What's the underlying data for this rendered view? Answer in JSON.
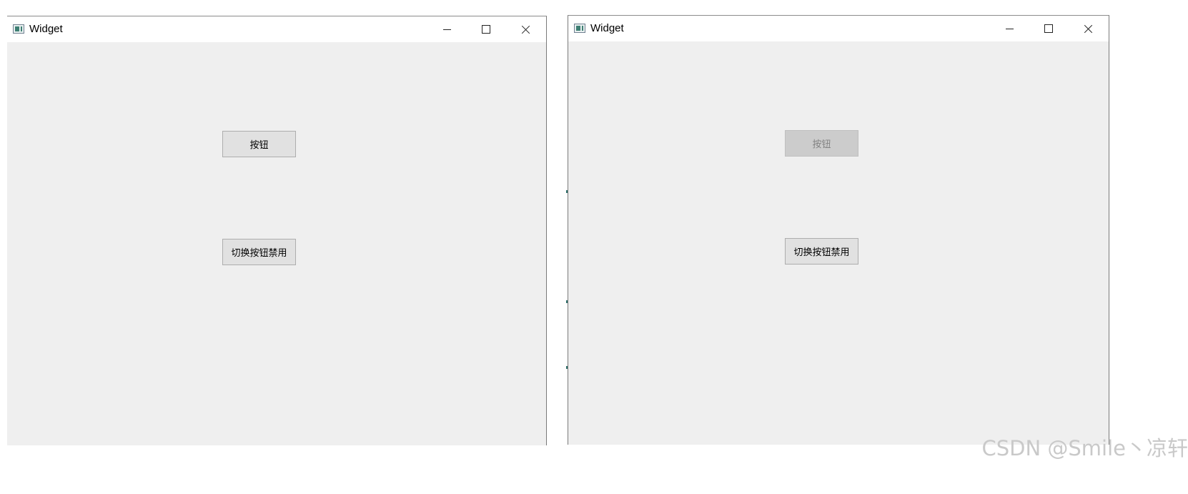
{
  "windows": [
    {
      "title": "Widget",
      "buttons": [
        {
          "label": "按钮",
          "state": "enabled"
        },
        {
          "label": "切换按钮禁用",
          "state": "enabled"
        }
      ]
    },
    {
      "title": "Widget",
      "buttons": [
        {
          "label": "按钮",
          "state": "disabled"
        },
        {
          "label": "切换按钮禁用",
          "state": "enabled"
        }
      ]
    }
  ],
  "window_controls": {
    "minimize": "minimize-icon",
    "maximize": "maximize-icon",
    "close": "close-icon"
  },
  "watermark": "CSDN @Smile丶凉轩",
  "colors": {
    "client_bg": "#efefef",
    "titlebar_bg": "#ffffff",
    "button_bg": "#e1e1e1",
    "button_disabled_bg": "#cccccc",
    "button_disabled_text": "#838383",
    "watermark": "#c9c9c9"
  }
}
